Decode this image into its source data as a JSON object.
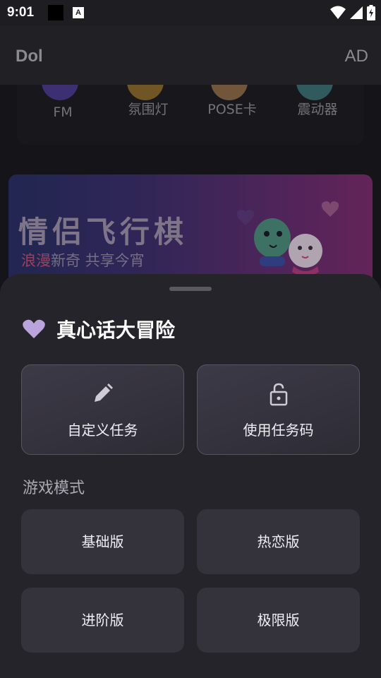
{
  "status_bar": {
    "time": "9:01",
    "notification_letter": "A",
    "icons": [
      "wifi-icon",
      "signal-icon",
      "battery-charging-icon"
    ]
  },
  "app_bar": {
    "title": "Dol",
    "ad_label": "AD"
  },
  "features": [
    {
      "label": "FM",
      "color": "#4b3b8c"
    },
    {
      "label": "氛围灯",
      "color": "#8a6a2e"
    },
    {
      "label": "POSE卡",
      "color": "#8a6a4a"
    },
    {
      "label": "震动器",
      "color": "#3b6e72"
    }
  ],
  "banner": {
    "title": "情侣飞行棋",
    "subtitle_highlight": "浪漫",
    "subtitle_rest": "新奇 共享今宵"
  },
  "sheet": {
    "title": "真心话大冒险",
    "title_icon": "heart-icon",
    "actions": [
      {
        "label": "自定义任务",
        "icon": "pencil-icon"
      },
      {
        "label": "使用任务码",
        "icon": "lock-icon"
      }
    ],
    "section_label": "游戏模式",
    "modes": [
      "基础版",
      "热恋版",
      "进阶版",
      "极限版"
    ]
  },
  "colors": {
    "background": "#1a191e",
    "sheet": "#25242b",
    "mode_button": "#34333c",
    "accent_heart": "#b9a4dc",
    "banner_highlight": "#c0506f"
  }
}
